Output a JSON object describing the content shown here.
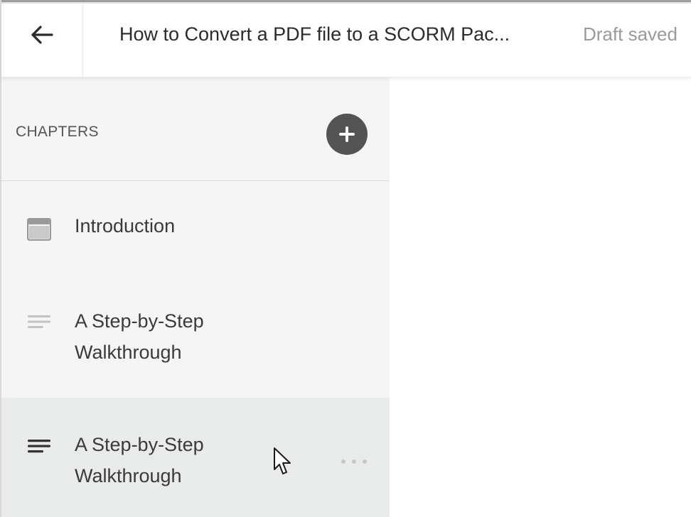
{
  "header": {
    "back_icon": "arrow-left-icon",
    "title": "How to Convert a PDF file to a SCORM Pac...",
    "status": "Draft saved"
  },
  "sidebar": {
    "heading": "CHAPTERS",
    "add_icon": "plus-circle-icon",
    "chapters": [
      {
        "label": "Introduction",
        "icon": "page-icon",
        "active": false
      },
      {
        "label": "A Step-by-Step Walkthrough",
        "icon": "text-lines-icon",
        "active": false
      },
      {
        "label": "A Step-by-Step Walkthrough",
        "icon": "text-lines-icon",
        "active": true,
        "more_icon": "more-horizontal-icon"
      }
    ]
  },
  "colors": {
    "sidebar_bg": "#f5f5f5",
    "active_item_bg": "#e9eaea",
    "add_button": "#545454",
    "status_text": "#9a9a9a"
  }
}
